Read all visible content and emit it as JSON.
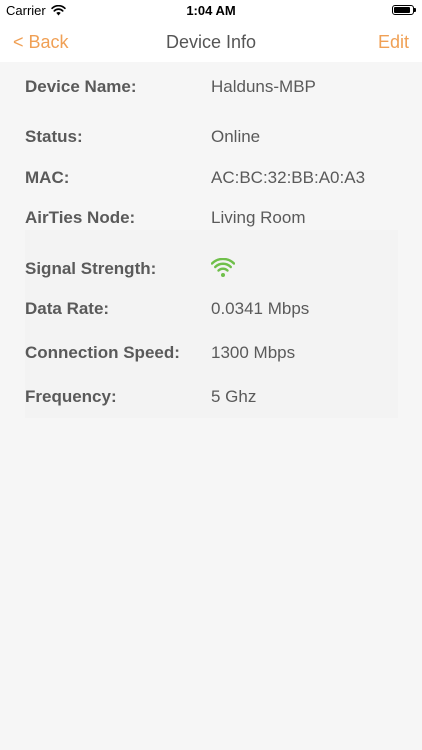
{
  "status_bar": {
    "carrier": "Carrier",
    "time": "1:04 AM"
  },
  "nav": {
    "back_label": "< Back",
    "title": "Device Info",
    "edit_label": "Edit"
  },
  "device": {
    "name": {
      "label": "Device Name:",
      "value": "Halduns-MBP"
    },
    "status": {
      "label": "Status:",
      "value": "Online"
    },
    "mac": {
      "label": "MAC:",
      "value": "AC:BC:32:BB:A0:A3"
    },
    "node": {
      "label": "AirTies Node:",
      "value": "Living Room"
    }
  },
  "connection": {
    "signal": {
      "label": "Signal Strength:",
      "icon": "wifi-signal-icon",
      "color": "#6fbf4a"
    },
    "data_rate": {
      "label": "Data Rate:",
      "value": "0.0341 Mbps"
    },
    "speed": {
      "label": "Connection Speed:",
      "value": "1300 Mbps"
    },
    "frequency": {
      "label": "Frequency:",
      "value": "5 Ghz"
    }
  },
  "colors": {
    "accent": "#f0a055",
    "text": "#5a5a5a",
    "background": "#f6f6f6",
    "signal": "#6fbf4a"
  }
}
